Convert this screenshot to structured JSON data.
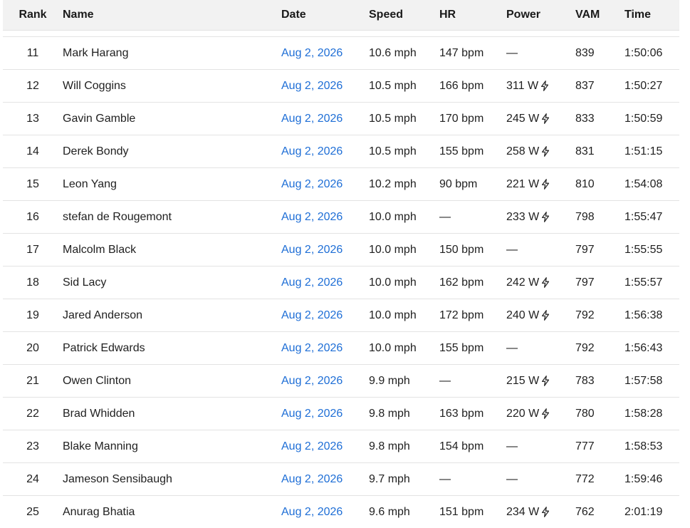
{
  "columns": {
    "rank": "Rank",
    "name": "Name",
    "date": "Date",
    "speed": "Speed",
    "hr": "HR",
    "power": "Power",
    "vam": "VAM",
    "time": "Time"
  },
  "icons": {
    "power_measured": "lightning-bolt-icon"
  },
  "colors": {
    "link": "#1e6ed6",
    "header_bg": "#f2f2f2"
  },
  "rows": [
    {
      "rank": "11",
      "name": "Mark Harang",
      "date": "Aug 2, 2026",
      "speed": "10.6 mph",
      "hr": "147 bpm",
      "power": "—",
      "power_icon": false,
      "vam": "839",
      "time": "1:50:06"
    },
    {
      "rank": "12",
      "name": "Will Coggins",
      "date": "Aug 2, 2026",
      "speed": "10.5 mph",
      "hr": "166 bpm",
      "power": "311 W",
      "power_icon": true,
      "vam": "837",
      "time": "1:50:27"
    },
    {
      "rank": "13",
      "name": "Gavin Gamble",
      "date": "Aug 2, 2026",
      "speed": "10.5 mph",
      "hr": "170 bpm",
      "power": "245 W",
      "power_icon": true,
      "vam": "833",
      "time": "1:50:59"
    },
    {
      "rank": "14",
      "name": "Derek Bondy",
      "date": "Aug 2, 2026",
      "speed": "10.5 mph",
      "hr": "155 bpm",
      "power": "258 W",
      "power_icon": true,
      "vam": "831",
      "time": "1:51:15"
    },
    {
      "rank": "15",
      "name": "Leon Yang",
      "date": "Aug 2, 2026",
      "speed": "10.2 mph",
      "hr": "90 bpm",
      "power": "221 W",
      "power_icon": true,
      "vam": "810",
      "time": "1:54:08"
    },
    {
      "rank": "16",
      "name": "stefan de Rougemont",
      "date": "Aug 2, 2026",
      "speed": "10.0 mph",
      "hr": "—",
      "power": "233 W",
      "power_icon": true,
      "vam": "798",
      "time": "1:55:47"
    },
    {
      "rank": "17",
      "name": "Malcolm Black",
      "date": "Aug 2, 2026",
      "speed": "10.0 mph",
      "hr": "150 bpm",
      "power": "—",
      "power_icon": false,
      "vam": "797",
      "time": "1:55:55"
    },
    {
      "rank": "18",
      "name": "Sid Lacy",
      "date": "Aug 2, 2026",
      "speed": "10.0 mph",
      "hr": "162 bpm",
      "power": "242 W",
      "power_icon": true,
      "vam": "797",
      "time": "1:55:57"
    },
    {
      "rank": "19",
      "name": "Jared Anderson",
      "date": "Aug 2, 2026",
      "speed": "10.0 mph",
      "hr": "172 bpm",
      "power": "240 W",
      "power_icon": true,
      "vam": "792",
      "time": "1:56:38"
    },
    {
      "rank": "20",
      "name": "Patrick Edwards",
      "date": "Aug 2, 2026",
      "speed": "10.0 mph",
      "hr": "155 bpm",
      "power": "—",
      "power_icon": false,
      "vam": "792",
      "time": "1:56:43"
    },
    {
      "rank": "21",
      "name": "Owen Clinton",
      "date": "Aug 2, 2026",
      "speed": "9.9 mph",
      "hr": "—",
      "power": "215 W",
      "power_icon": true,
      "vam": "783",
      "time": "1:57:58"
    },
    {
      "rank": "22",
      "name": "Brad Whidden",
      "date": "Aug 2, 2026",
      "speed": "9.8 mph",
      "hr": "163 bpm",
      "power": "220 W",
      "power_icon": true,
      "vam": "780",
      "time": "1:58:28"
    },
    {
      "rank": "23",
      "name": "Blake Manning",
      "date": "Aug 2, 2026",
      "speed": "9.8 mph",
      "hr": "154 bpm",
      "power": "—",
      "power_icon": false,
      "vam": "777",
      "time": "1:58:53"
    },
    {
      "rank": "24",
      "name": "Jameson Sensibaugh",
      "date": "Aug 2, 2026",
      "speed": "9.7 mph",
      "hr": "—",
      "power": "—",
      "power_icon": false,
      "vam": "772",
      "time": "1:59:46"
    },
    {
      "rank": "25",
      "name": "Anurag Bhatia",
      "date": "Aug 2, 2026",
      "speed": "9.6 mph",
      "hr": "151 bpm",
      "power": "234 W",
      "power_icon": true,
      "vam": "762",
      "time": "2:01:19"
    }
  ]
}
